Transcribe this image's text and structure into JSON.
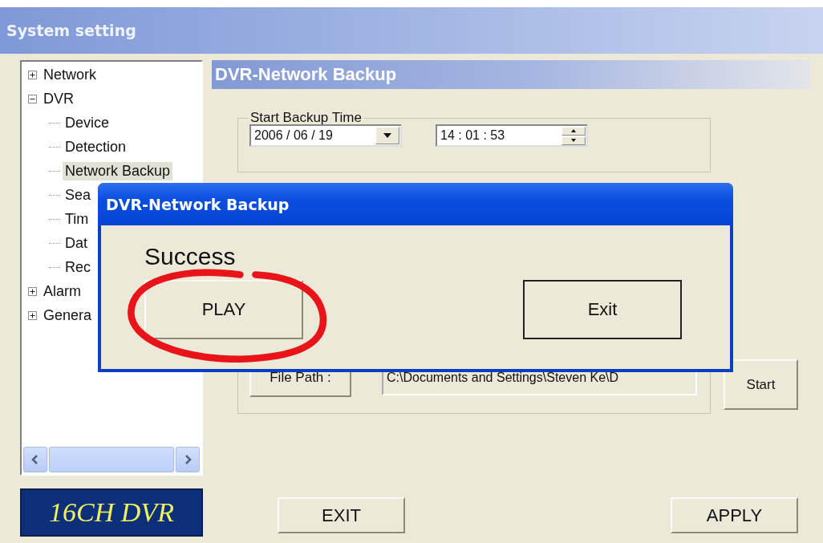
{
  "window": {
    "title": "System setting"
  },
  "tree": [
    {
      "label": "Network",
      "expanded": false,
      "selected": false
    },
    {
      "label": "DVR",
      "expanded": true,
      "selected": false,
      "children": [
        {
          "label": "Device",
          "selected": false
        },
        {
          "label": "Detection",
          "selected": false
        },
        {
          "label": "Network Backup",
          "selected": true
        },
        {
          "label": "Sea",
          "selected": false
        },
        {
          "label": "Tim",
          "selected": false
        },
        {
          "label": "Dat",
          "selected": false
        },
        {
          "label": "Rec",
          "selected": false
        }
      ]
    },
    {
      "label": "Alarm",
      "expanded": false,
      "selected": false
    },
    {
      "label": "Genera",
      "expanded": false,
      "selected": false
    }
  ],
  "logo": "16CH DVR",
  "panel": {
    "title": "DVR-Network Backup",
    "start_time": {
      "legend": "Start Backup Time",
      "date": "2006 / 06 / 19",
      "time": "14 : 01 : 53"
    },
    "file_path": {
      "button": "File Path :",
      "value": "C:\\Documents and Settings\\Steven Ke\\D"
    },
    "start_button": "Start"
  },
  "footer_buttons": [
    "EXIT",
    "APPLY"
  ],
  "dialog": {
    "title": "DVR-Network Backup",
    "message": "Success",
    "buttons": [
      "PLAY",
      "Exit"
    ]
  },
  "annotation": {
    "kind": "ellipse"
  }
}
